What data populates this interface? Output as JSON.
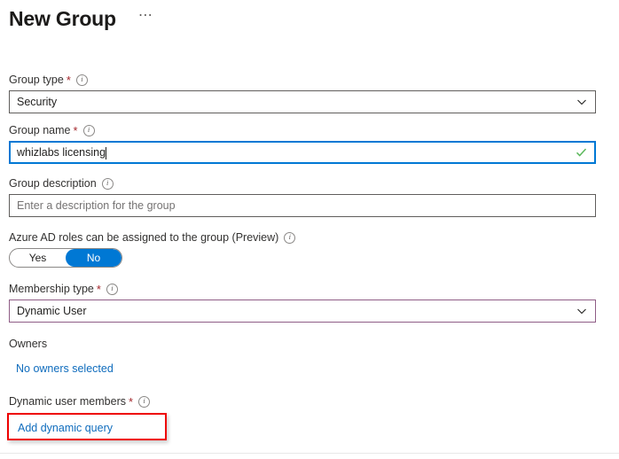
{
  "header": {
    "title": "New Group",
    "more_menu": "⋯"
  },
  "form": {
    "group_type": {
      "label": "Group type",
      "required": true,
      "value": "Security",
      "icon": "info-icon",
      "chevron": "chevron-down-icon"
    },
    "group_name": {
      "label": "Group name",
      "required": true,
      "value": "whizlabs licensing",
      "icon": "info-icon",
      "validation": "checkmark-icon",
      "focused": true
    },
    "group_description": {
      "label": "Group description",
      "required": false,
      "value": "",
      "placeholder": "Enter a description for the group",
      "icon": "info-icon"
    },
    "azure_ad_roles": {
      "label": "Azure AD roles can be assigned to the group (Preview)",
      "icon": "info-icon",
      "options": [
        "Yes",
        "No"
      ],
      "selected": "No"
    },
    "membership_type": {
      "label": "Membership type",
      "required": true,
      "value": "Dynamic User",
      "icon": "info-icon",
      "chevron": "chevron-down-icon"
    },
    "owners": {
      "label": "Owners",
      "link_text": "No owners selected"
    },
    "dynamic_user_members": {
      "label": "Dynamic user members",
      "required": true,
      "icon": "info-icon",
      "link_text": "Add dynamic query",
      "highlighted": true
    }
  },
  "colors": {
    "accent_blue": "#0078d4",
    "link_blue": "#0f6cbd",
    "required_red": "#a4262c",
    "annotation_red": "#ee0000",
    "purple_border": "#8f5d86",
    "success_green": "#5cb85c",
    "border_gray": "#605e5c"
  }
}
